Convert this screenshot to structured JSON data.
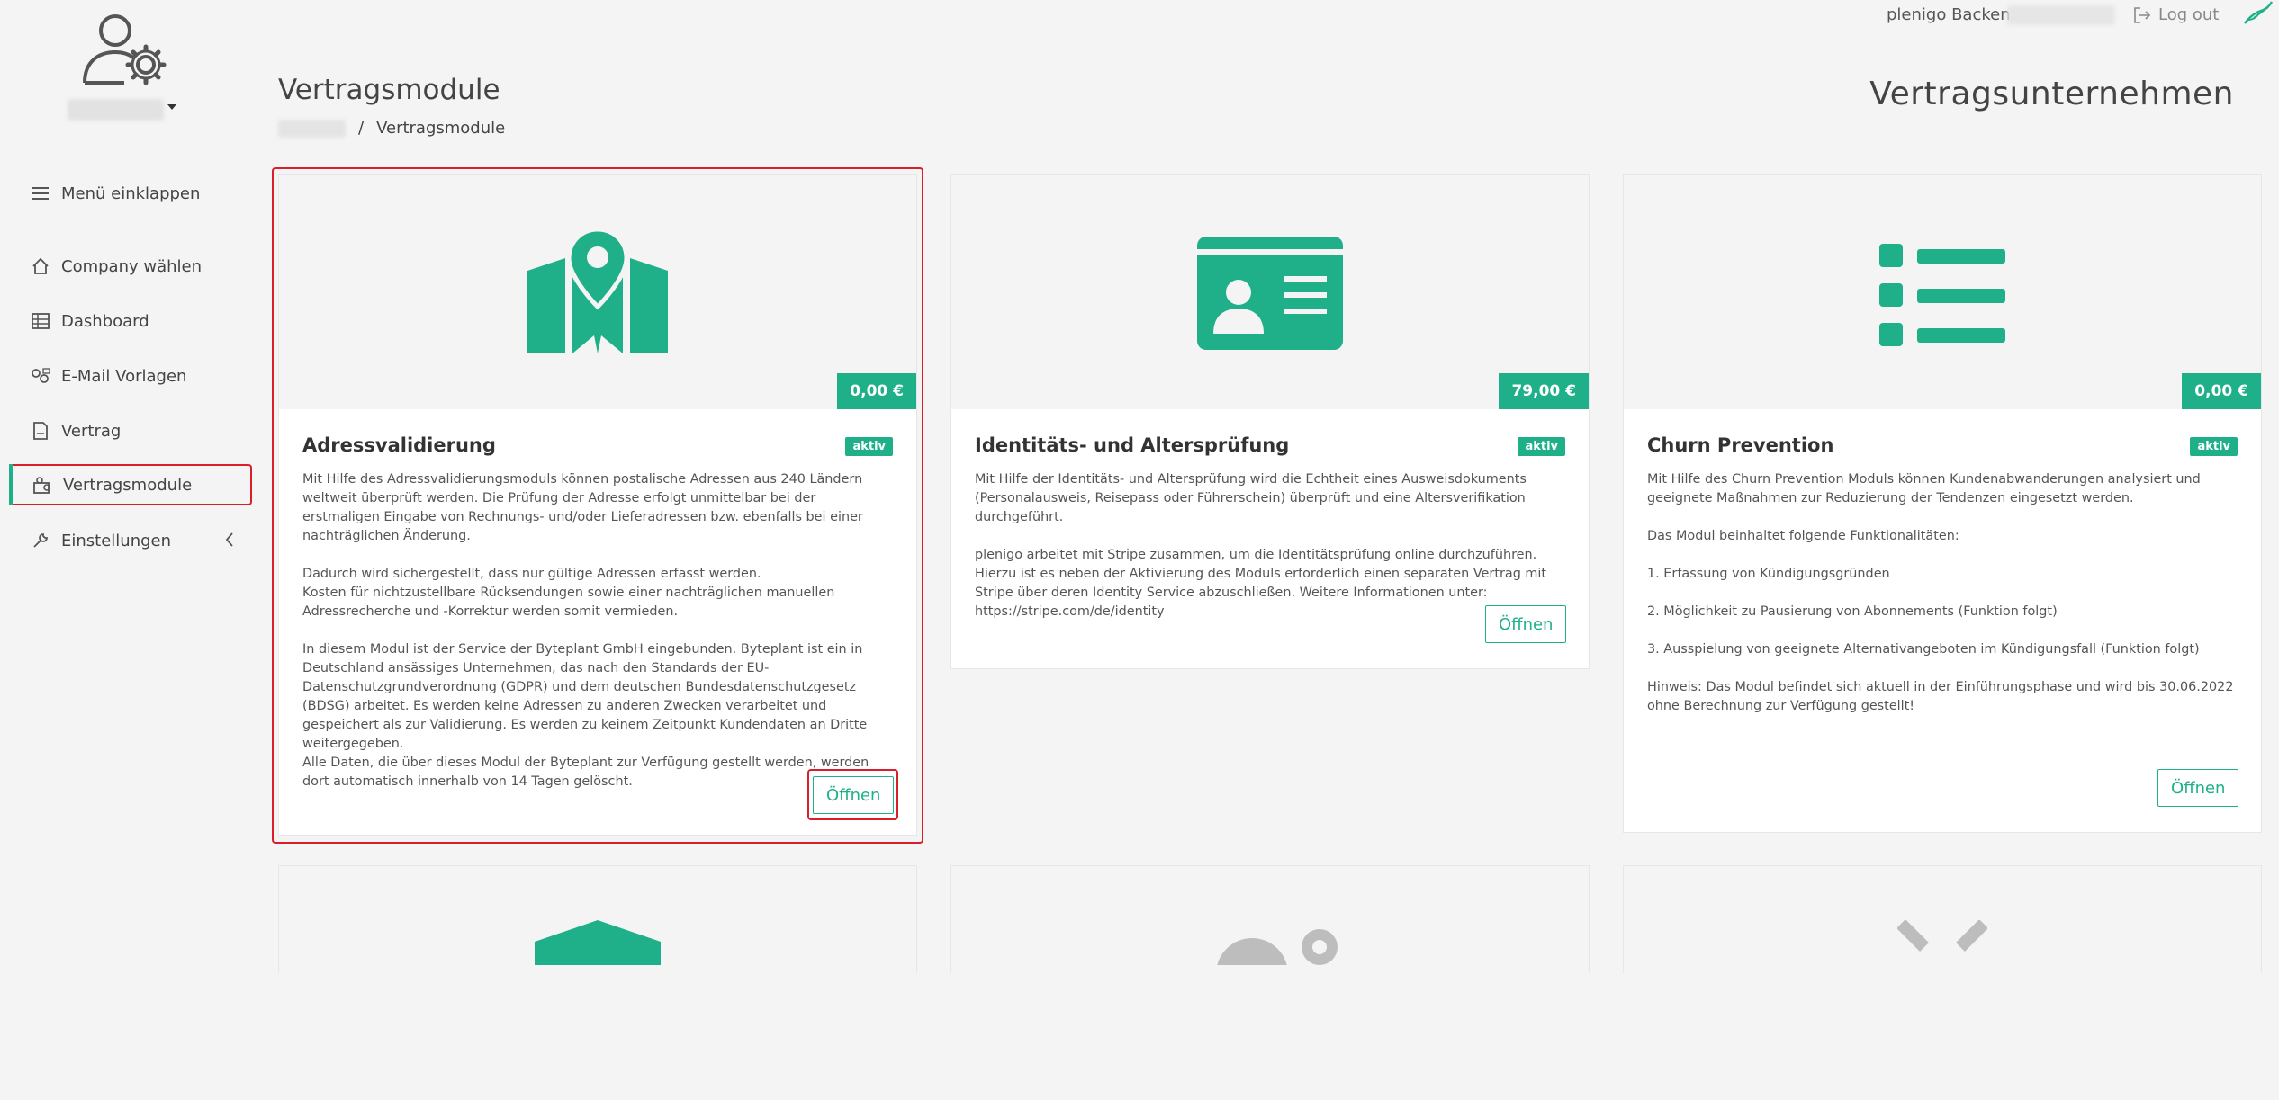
{
  "sidebar": {
    "items": [
      {
        "label": "Menü einklappen",
        "icon": "hamburger-icon"
      },
      {
        "label": "Company wählen",
        "icon": "home-icon"
      },
      {
        "label": "Dashboard",
        "icon": "table-icon"
      },
      {
        "label": "E-Mail Vorlagen",
        "icon": "email-gear-icon"
      },
      {
        "label": "Vertrag",
        "icon": "document-icon"
      },
      {
        "label": "Vertragsmodule",
        "icon": "modules-icon"
      },
      {
        "label": "Einstellungen",
        "icon": "wrench-icon"
      }
    ]
  },
  "topbar": {
    "backend_label": "plenigo Backend",
    "logout_label": "Log out"
  },
  "header": {
    "title": "Vertragsmodule",
    "breadcrumb_current": "Vertragsmodule",
    "breadcrumb_separator": "/",
    "company_title": "Vertragsunternehmen"
  },
  "cards": [
    {
      "title": "Adressvalidierung",
      "price": "0,00 €",
      "badge": "aktiv",
      "icon": "map-pin-icon",
      "text": "Mit Hilfe des Adressvalidierungsmoduls können postalische Adressen aus 240 Ländern weltweit überprüft werden. Die Prüfung der Adresse erfolgt unmittelbar bei der erstmaligen Eingabe von Rechnungs- und/oder Lieferadressen bzw. ebenfalls bei einer nachträglichen Änderung.\n\nDadurch wird sichergestellt, dass nur gültige Adressen erfasst werden.\nKosten für nichtzustellbare Rücksendungen sowie einer nachträglichen manuellen Adressrecherche und -Korrektur werden somit vermieden.\n\nIn diesem Modul ist der Service der Byteplant GmbH eingebunden. Byteplant ist ein in Deutschland ansässiges Unternehmen, das nach den Standards der EU-Datenschutzgrundverordnung (GDPR) und dem deutschen Bundesdatenschutzgesetz (BDSG) arbeitet. Es werden keine Adressen zu anderen Zwecken verarbeitet und gespeichert als zur Validierung. Es werden zu keinem Zeitpunkt Kundendaten an Dritte weitergegeben.\nAlle Daten, die über dieses Modul der Byteplant zur Verfügung gestellt werden, werden dort automatisch innerhalb von 14 Tagen gelöscht.",
      "button": "Öffnen"
    },
    {
      "title": "Identitäts- und Altersprüfung",
      "price": "79,00 €",
      "badge": "aktiv",
      "icon": "id-card-icon",
      "text": "Mit Hilfe der Identitäts- und Altersprüfung wird die Echtheit eines Ausweisdokuments (Personalausweis, Reisepass oder Führerschein) überprüft und eine Altersverifikation durchgeführt.\n\nplenigo arbeitet mit Stripe zusammen, um die Identitätsprüfung online durchzuführen. Hierzu ist es neben der Aktivierung des Moduls erforderlich einen separaten Vertrag mit Stripe über deren Identity Service abzuschließen. Weitere Informationen unter: https://stripe.com/de/identity",
      "button": "Öffnen"
    },
    {
      "title": "Churn Prevention",
      "price": "0,00 €",
      "badge": "aktiv",
      "icon": "list-icon",
      "text": "Mit Hilfe des Churn Prevention Moduls können Kundenabwanderungen analysiert und geeignete Maßnahmen zur Reduzierung der Tendenzen eingesetzt werden.\n\nDas Modul beinhaltet folgende Funktionalitäten:\n\n1. Erfassung von Kündigungsgründen\n\n2. Möglichkeit zu Pausierung von Abonnements (Funktion folgt)\n\n3. Ausspielung von geeignete Alternativangeboten im Kündigungsfall (Funktion folgt)\n\nHinweis: Das Modul befindet sich aktuell in der Einführungsphase und wird bis 30.06.2022 ohne Berechnung zur Verfügung gestellt!",
      "button": "Öffnen"
    }
  ],
  "colors": {
    "accent": "#1fb089",
    "highlight": "#d9202a"
  }
}
